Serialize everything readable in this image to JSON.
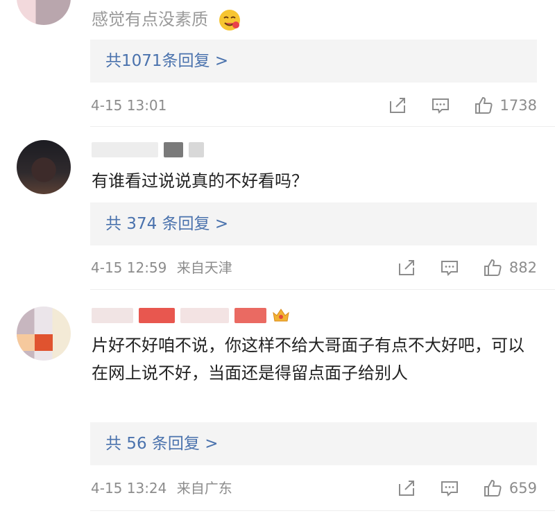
{
  "comments": [
    {
      "text": "感觉有点没素质",
      "reply_link": "共1071条回复 >",
      "timestamp": "4-15 13:01",
      "location": "",
      "likes": "1738"
    },
    {
      "text": "有谁看过说说真的不好看吗？",
      "reply_link": "共 374 条回复 >",
      "timestamp": "4-15 12:59",
      "location": "来自天津",
      "likes": "882"
    },
    {
      "text": "片好不好咱不说，你这样不给大哥面子有点不大好吧，可以在网上说不好，当面还是得留点面子给别人",
      "reply_link": "共 56 条回复 >",
      "timestamp": "4-15 13:24",
      "location": "来自广东",
      "likes": "659"
    }
  ],
  "colors": {
    "link": "#4a72ad",
    "meta": "#8c8c8c",
    "reply_bg": "#f4f4f4"
  },
  "icons": {
    "share": "share-icon",
    "comment": "comment-icon",
    "like": "thumbs-up-icon",
    "emoji": "smiling-face-emoji",
    "badge": "crown-badge-icon"
  }
}
